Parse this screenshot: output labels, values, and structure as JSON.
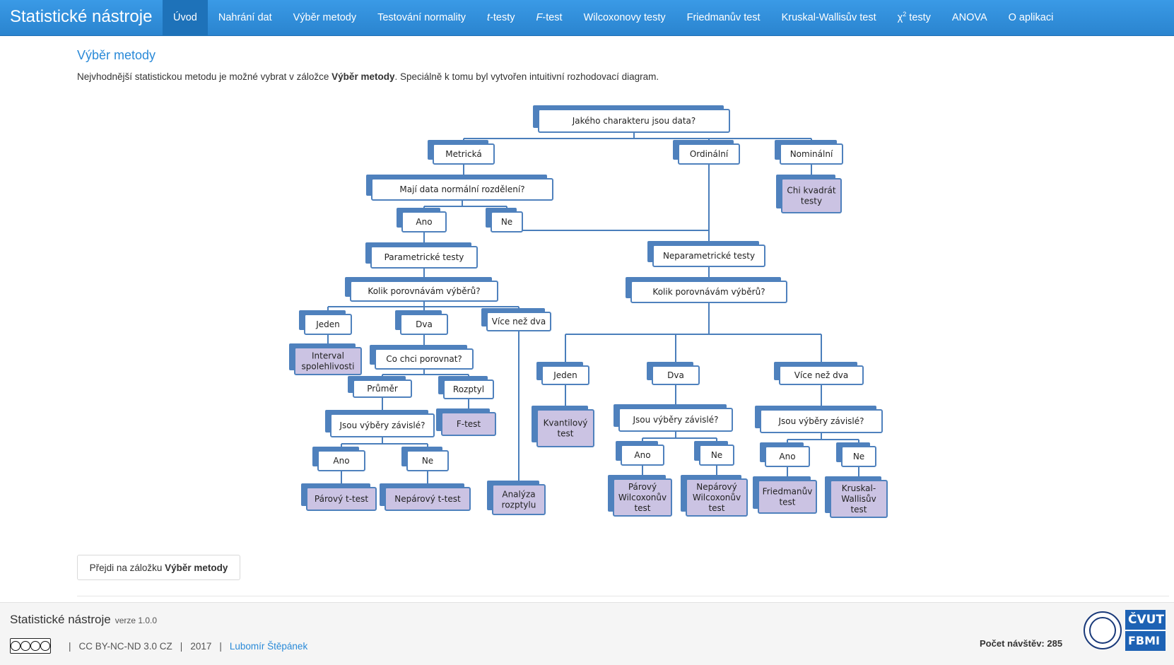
{
  "navbar": {
    "brand": "Statistické nástroje",
    "items": [
      {
        "label": "Úvod",
        "active": true
      },
      {
        "label": "Nahrání dat"
      },
      {
        "label": "Výběr metody"
      },
      {
        "label": "Testování normality"
      },
      {
        "label_italic": "t",
        "label": "-testy"
      },
      {
        "label_italic": "F",
        "label": "-test"
      },
      {
        "label": "Wilcoxonovy testy"
      },
      {
        "label": "Friedmanův test"
      },
      {
        "label": "Kruskal-Wallisův test"
      },
      {
        "label_prefix": "χ",
        "label_sup": "2",
        "label": " testy"
      },
      {
        "label": "ANOVA"
      },
      {
        "label": "O aplikaci"
      }
    ]
  },
  "main": {
    "title": "Výběr metody",
    "intro_before": "Nejvhodnější statistickou metodu je možné vybrat v záložce ",
    "intro_bold": "Výběr metody",
    "intro_after": ". Speciálně k tomu byl vytvořen intuitivní rozhodovací diagram.",
    "button_before": "Přejdi na záložku ",
    "button_bold": "Výběr metody"
  },
  "diagram": {
    "nodes": [
      {
        "id": "root",
        "lines": [
          "Jakého charakteru jsou data?"
        ]
      },
      {
        "id": "metric",
        "lines": [
          "Metrická"
        ]
      },
      {
        "id": "ordinal",
        "lines": [
          "Ordinální"
        ]
      },
      {
        "id": "nominal",
        "lines": [
          "Nominální"
        ]
      },
      {
        "id": "chi",
        "lines": [
          "Chi kvadrát",
          "testy"
        ],
        "result": true
      },
      {
        "id": "normal",
        "lines": [
          "Mají data normální rozdělení?"
        ]
      },
      {
        "id": "yes1",
        "lines": [
          "Ano"
        ]
      },
      {
        "id": "no1",
        "lines": [
          "Ne"
        ]
      },
      {
        "id": "param",
        "lines": [
          "Parametrické testy"
        ]
      },
      {
        "id": "nonparam",
        "lines": [
          "Neparametrické testy"
        ]
      },
      {
        "id": "howmanyP",
        "lines": [
          "Kolik porovnávám výběrů?"
        ]
      },
      {
        "id": "howmanyN",
        "lines": [
          "Kolik porovnávám výběrů?"
        ]
      },
      {
        "id": "oneP",
        "lines": [
          "Jeden"
        ]
      },
      {
        "id": "twoP",
        "lines": [
          "Dva"
        ]
      },
      {
        "id": "moreP",
        "lines": [
          "Více než dva"
        ]
      },
      {
        "id": "interval",
        "lines": [
          "Interval",
          "spolehlivosti"
        ],
        "result": true
      },
      {
        "id": "compare",
        "lines": [
          "Co chci porovnat?"
        ]
      },
      {
        "id": "mean",
        "lines": [
          "Průměr"
        ]
      },
      {
        "id": "var",
        "lines": [
          "Rozptyl"
        ]
      },
      {
        "id": "ftest",
        "lines": [
          "F-test"
        ],
        "result": true
      },
      {
        "id": "depP",
        "lines": [
          "Jsou výběry závislé?"
        ]
      },
      {
        "id": "yesP",
        "lines": [
          "Ano"
        ]
      },
      {
        "id": "noP",
        "lines": [
          "Ne"
        ]
      },
      {
        "id": "paired",
        "lines": [
          "Párový t-test"
        ],
        "result": true
      },
      {
        "id": "unpaired",
        "lines": [
          "Nepárový t-test"
        ],
        "result": true
      },
      {
        "id": "anova",
        "lines": [
          "Analýza",
          "rozptylu"
        ],
        "result": true
      },
      {
        "id": "oneN",
        "lines": [
          "Jeden"
        ]
      },
      {
        "id": "twoN",
        "lines": [
          "Dva"
        ]
      },
      {
        "id": "moreN",
        "lines": [
          "Více než dva"
        ]
      },
      {
        "id": "quant",
        "lines": [
          "Kvantilový",
          "test"
        ],
        "result": true
      },
      {
        "id": "dep2",
        "lines": [
          "Jsou výběry závislé?"
        ]
      },
      {
        "id": "dep3",
        "lines": [
          "Jsou výběry závislé?"
        ]
      },
      {
        "id": "yes2",
        "lines": [
          "Ano"
        ]
      },
      {
        "id": "no2",
        "lines": [
          "Ne"
        ]
      },
      {
        "id": "yes3",
        "lines": [
          "Ano"
        ]
      },
      {
        "id": "no3",
        "lines": [
          "Ne"
        ]
      },
      {
        "id": "pwil",
        "lines": [
          "Párový",
          "Wilcoxonův",
          "test"
        ],
        "result": true
      },
      {
        "id": "npwil",
        "lines": [
          "Nepárový",
          "Wilcoxonův",
          "test"
        ],
        "result": true
      },
      {
        "id": "fried",
        "lines": [
          "Friedmanův",
          "test"
        ],
        "result": true
      },
      {
        "id": "kw",
        "lines": [
          "Kruskal-",
          "Wallisův",
          "test"
        ],
        "result": true
      }
    ],
    "colors": {
      "node_fill": "#ffffff",
      "result_fill": "#cbc3e3",
      "shadow": "#4f81bd",
      "line": "#4a7ebb"
    }
  },
  "footer": {
    "title": "Statistické nástroje",
    "version": "verze 1.0.0",
    "license": "CC BY-NC-ND 3.0 CZ",
    "year": "2017",
    "author": "Lubomír Štěpánek",
    "visits": "Počet návštěv: 285",
    "logo_line1": "ČVUT",
    "logo_line2": "FBMI"
  }
}
